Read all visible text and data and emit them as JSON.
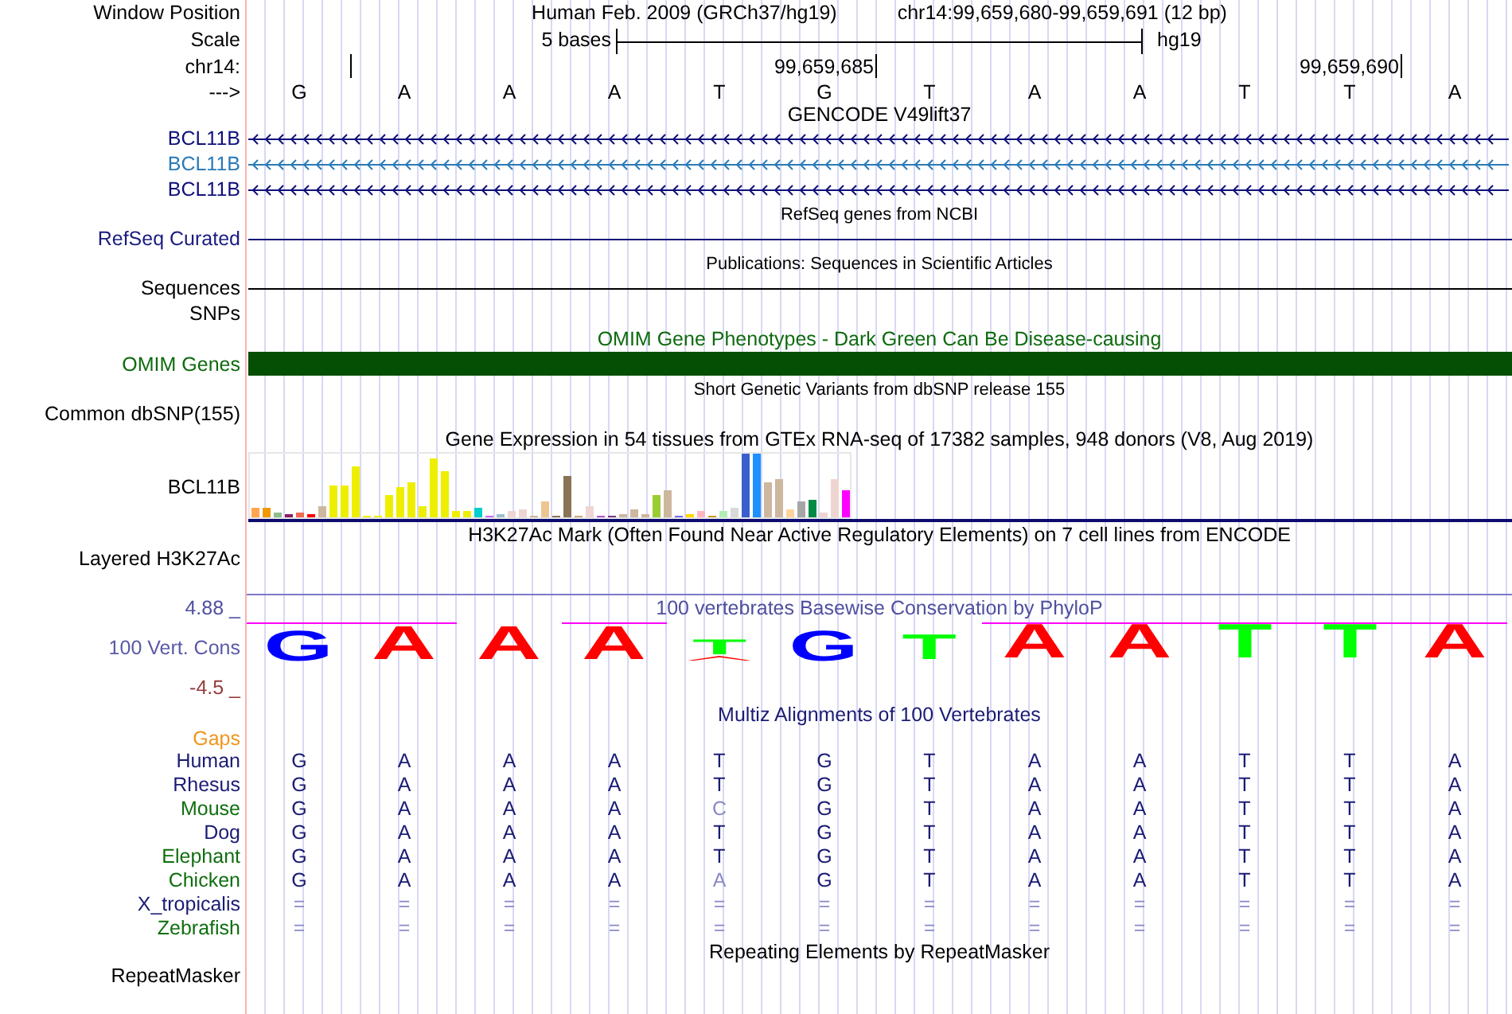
{
  "position": {
    "label": "Window Position",
    "assembly": "Human Feb. 2009 (GRCh37/hg19)",
    "range": "chr14:99,659,680-99,659,691 (12 bp)"
  },
  "scale": {
    "label": "Scale",
    "length": "5 bases",
    "assembly": "hg19"
  },
  "ruler": {
    "label": "chr14:",
    "ticks": [
      {
        "kind": "unlabeled"
      },
      {
        "kind": "labeled",
        "label": "99,659,685"
      },
      {
        "kind": "labeled",
        "label": "99,659,690"
      }
    ]
  },
  "sequence": {
    "label": "--->",
    "bases": [
      "G",
      "A",
      "A",
      "A",
      "T",
      "G",
      "T",
      "A",
      "A",
      "T",
      "T",
      "A"
    ]
  },
  "gencode": {
    "title": "GENCODE V49lift37",
    "transcripts": [
      {
        "name": "BCL11B",
        "color": "#10107a"
      },
      {
        "name": "BCL11B",
        "color": "#2a7ab8"
      },
      {
        "name": "BCL11B",
        "color": "#10107a"
      }
    ]
  },
  "refseq": {
    "title": "RefSeq genes from NCBI",
    "label": "RefSeq Curated"
  },
  "publications": {
    "title": "Publications: Sequences in Scientific Articles",
    "label": "Sequences"
  },
  "snps": {
    "label": "SNPs"
  },
  "omim": {
    "title": "OMIM Gene Phenotypes - Dark Green Can Be Disease-causing",
    "label": "OMIM Genes"
  },
  "dbsnp": {
    "title": "Short Genetic Variants from dbSNP release 155",
    "label": "Common dbSNP(155)"
  },
  "gtex": {
    "title": "Gene Expression in 54 tissues from GTEx RNA-seq of 17382 samples, 948 donors (V8, Aug 2019)",
    "label": "BCL11B"
  },
  "h3k27ac": {
    "title": "H3K27Ac Mark (Often Found Near Active Regulatory Elements) on 7 cell lines from ENCODE",
    "label": "Layered H3K27Ac"
  },
  "conservation": {
    "title": "100 vertebrates Basewise Conservation by PhyloP",
    "label": "100 Vert. Cons",
    "max_label": "4.88 _",
    "min_label": "-4.5 _",
    "logo": [
      {
        "letter": "G",
        "color": "#0000ff",
        "clipped": true
      },
      {
        "letter": "A",
        "color": "#ff0000",
        "clipped": true
      },
      {
        "letter": "A",
        "color": "#ff0000",
        "clipped": false
      },
      {
        "letter": "A",
        "color": "#ff0000",
        "clipped": true
      },
      {
        "letter": "T",
        "color": "#00ff00",
        "clipped": false
      },
      {
        "letter": "G",
        "color": "#0000ff",
        "clipped": false
      },
      {
        "letter": "T",
        "color": "#00ff00",
        "clipped": false
      },
      {
        "letter": "A",
        "color": "#ff0000",
        "clipped": true
      },
      {
        "letter": "A",
        "color": "#ff0000",
        "clipped": true
      },
      {
        "letter": "T",
        "color": "#00ff00",
        "clipped": true
      },
      {
        "letter": "T",
        "color": "#00ff00",
        "clipped": true
      },
      {
        "letter": "A",
        "color": "#ff0000",
        "clipped": true
      }
    ]
  },
  "multiz": {
    "title": "Multiz Alignments of 100 Vertebrates",
    "gaps_label": "Gaps",
    "species": [
      {
        "name": "Human",
        "color": "#1b1b74",
        "bases": [
          {
            "base": "G",
            "faint": false
          },
          {
            "base": "A",
            "faint": false
          },
          {
            "base": "A",
            "faint": false
          },
          {
            "base": "A",
            "faint": false
          },
          {
            "base": "T",
            "faint": false
          },
          {
            "base": "G",
            "faint": false
          },
          {
            "base": "T",
            "faint": false
          },
          {
            "base": "A",
            "faint": false
          },
          {
            "base": "A",
            "faint": false
          },
          {
            "base": "T",
            "faint": false
          },
          {
            "base": "T",
            "faint": false
          },
          {
            "base": "A",
            "faint": false
          }
        ]
      },
      {
        "name": "Rhesus",
        "color": "#1b1b74",
        "bases": [
          {
            "base": "G",
            "faint": false
          },
          {
            "base": "A",
            "faint": false
          },
          {
            "base": "A",
            "faint": false
          },
          {
            "base": "A",
            "faint": false
          },
          {
            "base": "T",
            "faint": false
          },
          {
            "base": "G",
            "faint": false
          },
          {
            "base": "T",
            "faint": false
          },
          {
            "base": "A",
            "faint": false
          },
          {
            "base": "A",
            "faint": false
          },
          {
            "base": "T",
            "faint": false
          },
          {
            "base": "T",
            "faint": false
          },
          {
            "base": "A",
            "faint": false
          }
        ]
      },
      {
        "name": "Mouse",
        "color": "#0f6e0f",
        "bases": [
          {
            "base": "G",
            "faint": false
          },
          {
            "base": "A",
            "faint": false
          },
          {
            "base": "A",
            "faint": false
          },
          {
            "base": "A",
            "faint": false
          },
          {
            "base": "C",
            "faint": true
          },
          {
            "base": "G",
            "faint": false
          },
          {
            "base": "T",
            "faint": false
          },
          {
            "base": "A",
            "faint": false
          },
          {
            "base": "A",
            "faint": false
          },
          {
            "base": "T",
            "faint": false
          },
          {
            "base": "T",
            "faint": false
          },
          {
            "base": "A",
            "faint": false
          }
        ]
      },
      {
        "name": "Dog",
        "color": "#1b1b74",
        "bases": [
          {
            "base": "G",
            "faint": false
          },
          {
            "base": "A",
            "faint": false
          },
          {
            "base": "A",
            "faint": false
          },
          {
            "base": "A",
            "faint": false
          },
          {
            "base": "T",
            "faint": false
          },
          {
            "base": "G",
            "faint": false
          },
          {
            "base": "T",
            "faint": false
          },
          {
            "base": "A",
            "faint": false
          },
          {
            "base": "A",
            "faint": false
          },
          {
            "base": "T",
            "faint": false
          },
          {
            "base": "T",
            "faint": false
          },
          {
            "base": "A",
            "faint": false
          }
        ]
      },
      {
        "name": "Elephant",
        "color": "#0f6e0f",
        "bases": [
          {
            "base": "G",
            "faint": false
          },
          {
            "base": "A",
            "faint": false
          },
          {
            "base": "A",
            "faint": false
          },
          {
            "base": "A",
            "faint": false
          },
          {
            "base": "T",
            "faint": false
          },
          {
            "base": "G",
            "faint": false
          },
          {
            "base": "T",
            "faint": false
          },
          {
            "base": "A",
            "faint": false
          },
          {
            "base": "A",
            "faint": false
          },
          {
            "base": "T",
            "faint": false
          },
          {
            "base": "T",
            "faint": false
          },
          {
            "base": "A",
            "faint": false
          }
        ]
      },
      {
        "name": "Chicken",
        "color": "#0f6e0f",
        "bases": [
          {
            "base": "G",
            "faint": false
          },
          {
            "base": "A",
            "faint": false
          },
          {
            "base": "A",
            "faint": false
          },
          {
            "base": "A",
            "faint": false
          },
          {
            "base": "A",
            "faint": true
          },
          {
            "base": "G",
            "faint": false
          },
          {
            "base": "T",
            "faint": false
          },
          {
            "base": "A",
            "faint": false
          },
          {
            "base": "A",
            "faint": false
          },
          {
            "base": "T",
            "faint": false
          },
          {
            "base": "T",
            "faint": false
          },
          {
            "base": "A",
            "faint": false
          }
        ]
      },
      {
        "name": "X_tropicalis",
        "color": "#1b1b74",
        "bases": [
          {
            "base": "=",
            "faint": true
          },
          {
            "base": "=",
            "faint": true
          },
          {
            "base": "=",
            "faint": true
          },
          {
            "base": "=",
            "faint": true
          },
          {
            "base": "=",
            "faint": true
          },
          {
            "base": "=",
            "faint": true
          },
          {
            "base": "=",
            "faint": true
          },
          {
            "base": "=",
            "faint": true
          },
          {
            "base": "=",
            "faint": true
          },
          {
            "base": "=",
            "faint": true
          },
          {
            "base": "=",
            "faint": true
          },
          {
            "base": "=",
            "faint": true
          }
        ]
      },
      {
        "name": "Zebrafish",
        "color": "#0f6e0f",
        "bases": [
          {
            "base": "=",
            "faint": true
          },
          {
            "base": "=",
            "faint": true
          },
          {
            "base": "=",
            "faint": true
          },
          {
            "base": "=",
            "faint": true
          },
          {
            "base": "=",
            "faint": true
          },
          {
            "base": "=",
            "faint": true
          },
          {
            "base": "=",
            "faint": true
          },
          {
            "base": "=",
            "faint": true
          },
          {
            "base": "=",
            "faint": true
          },
          {
            "base": "=",
            "faint": true
          },
          {
            "base": "=",
            "faint": true
          },
          {
            "base": "=",
            "faint": true
          }
        ]
      }
    ]
  },
  "repeatmasker": {
    "title": "Repeating Elements by RepeatMasker",
    "label": "RepeatMasker"
  }
}
